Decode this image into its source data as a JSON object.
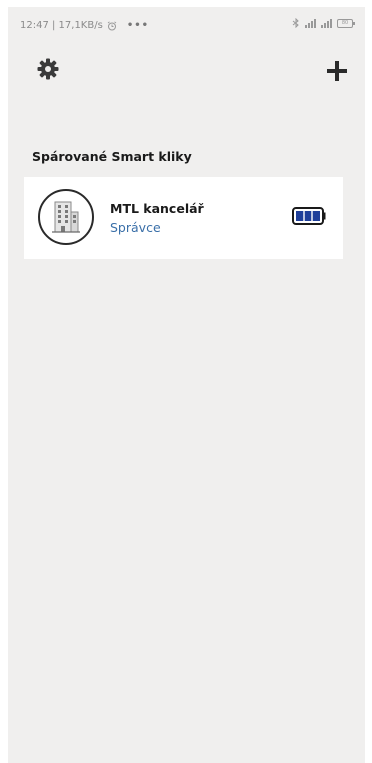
{
  "status_bar": {
    "left_text": "12:47 | 17,1KB/s",
    "dots": "•••",
    "battery_text": "80"
  },
  "header": {
    "settings_icon": "gear-icon",
    "add_icon": "plus-icon"
  },
  "section": {
    "title": "Spárované Smart kliky"
  },
  "devices": [
    {
      "name": "MTL kancelář",
      "role": "Správce",
      "icon": "building-icon",
      "battery_icon": "battery-full-icon",
      "battery_level": 1.0
    }
  ],
  "colors": {
    "background": "#f0efee",
    "card": "#ffffff",
    "role_text": "#3a6fa8",
    "battery_fill": "#1f3f9a"
  }
}
